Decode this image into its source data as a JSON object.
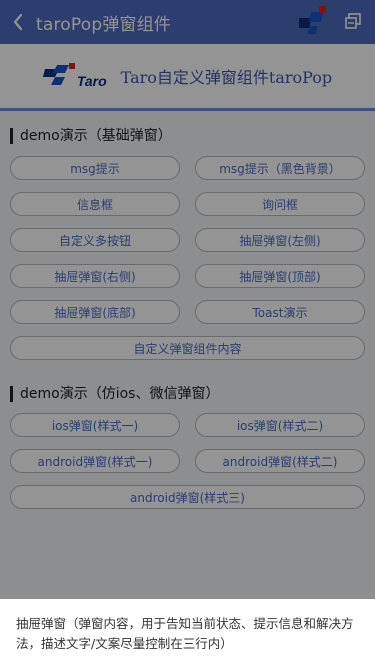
{
  "navbar": {
    "title": "taroPop弹窗组件",
    "back_icon": "chevron-left-icon",
    "logo_icon": "taro-mini-logo-icon",
    "action_icon": "window-restore-icon",
    "bg_color": "#4a6bbd"
  },
  "banner": {
    "logo_text": "Taro",
    "title": "Taro自定义弹窗组件taroPop"
  },
  "section1": {
    "title": "demo演示（基础弹窗）",
    "buttons": [
      "msg提示",
      "msg提示（黑色背景）",
      "信息框",
      "询问框",
      "自定义多按钮",
      "抽屉弹窗(左侧)",
      "抽屉弹窗(右侧)",
      "抽屉弹窗(顶部)",
      "抽屉弹窗(底部)",
      "Toast演示",
      "自定义弹窗组件内容"
    ]
  },
  "section2": {
    "title": "demo演示（仿ios、微信弹窗）",
    "buttons": [
      "ios弹窗(样式一)",
      "ios弹窗(样式二)",
      "android弹窗(样式一)",
      "android弹窗(样式二)",
      "android弹窗(样式三)"
    ]
  },
  "popup": {
    "text": "抽屉弹窗（弹窗内容，用于告知当前状态、提示信息和解决方法，描述文字/文案尽量控制在三行内）"
  }
}
